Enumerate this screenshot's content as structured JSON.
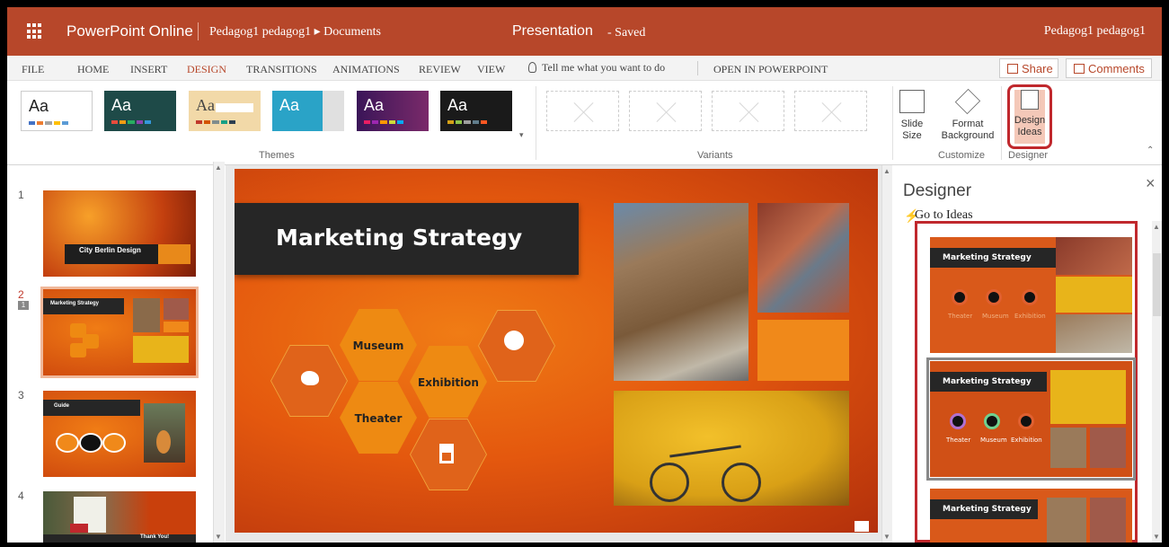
{
  "titlebar": {
    "app_name": "PowerPoint Online",
    "breadcrumb": "Pedagog1 pedagog1 ▸ Documents",
    "doc_title": "Presentation",
    "doc_status": "-   Saved",
    "user": "Pedagog1 pedagog1"
  },
  "tabs": [
    {
      "label": "FILE"
    },
    {
      "label": "HOME"
    },
    {
      "label": "INSERT"
    },
    {
      "label": "DESIGN"
    },
    {
      "label": "TRANSITIONS"
    },
    {
      "label": "ANIMATIONS"
    },
    {
      "label": "REVIEW"
    },
    {
      "label": "VIEW"
    }
  ],
  "tell_me": "Tell me what you want to do",
  "open_in": "OPEN IN POWERPOINT",
  "share_label": "Share",
  "comments_label": "Comments",
  "ribbon": {
    "themes_label": "Themes",
    "variants_label": "Variants",
    "customize_label": "Customize",
    "designer_label": "Designer",
    "theme_aa": "Aa",
    "slide_size_label": "Slide Size",
    "format_bg_label": "Format Background",
    "design_ideas_label": "Design Ideas"
  },
  "slides": [
    {
      "num": "1",
      "text": "City Berlin Design"
    },
    {
      "num": "2",
      "text": "Marketing Strategy"
    },
    {
      "num": "3",
      "text": "Guide"
    },
    {
      "num": "4",
      "text": "Thank You!"
    }
  ],
  "comment_count": "1",
  "current_slide": {
    "title": "Marketing Strategy",
    "hex_labels": [
      "Museum",
      "Exhibition",
      "Theater"
    ]
  },
  "designer": {
    "title": "Designer",
    "close": "×",
    "go_to_ideas": "Go to Ideas",
    "idea_title": "Marketing Strategy",
    "idea_labels": [
      "Theater",
      "Museum",
      "Exhibition"
    ]
  },
  "colors": {
    "accent": "#b7472a",
    "highlight": "#c0282d"
  }
}
